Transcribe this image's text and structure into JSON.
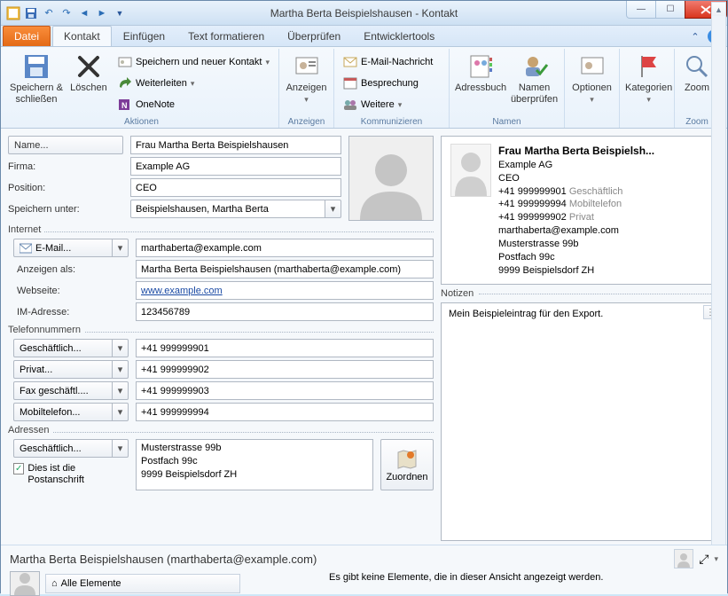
{
  "window": {
    "title": "Martha Berta Beispielshausen  -  Kontakt"
  },
  "tabs": {
    "file": "Datei",
    "items": [
      "Kontakt",
      "Einfügen",
      "Text formatieren",
      "Überprüfen",
      "Entwicklertools"
    ],
    "active_index": 0
  },
  "ribbon": {
    "save_close": "Speichern & schließen",
    "delete": "Löschen",
    "save_new": "Speichern und neuer Kontakt",
    "forward": "Weiterleiten",
    "onenote": "OneNote",
    "group_actions": "Aktionen",
    "show": "Anzeigen",
    "group_show": "Anzeigen",
    "email": "E-Mail-Nachricht",
    "meeting": "Besprechung",
    "more": "Weitere",
    "group_comm": "Kommunizieren",
    "addressbook": "Adressbuch",
    "checknames": "Namen überprüfen",
    "group_names": "Namen",
    "options": "Optionen",
    "categories": "Kategorien",
    "zoom": "Zoom",
    "group_zoom": "Zoom"
  },
  "form": {
    "name_btn": "Name...",
    "name_val": "Frau Martha Berta Beispielshausen",
    "firma_lbl": "Firma:",
    "firma_val": "Example AG",
    "position_lbl": "Position:",
    "position_val": "CEO",
    "fileas_lbl": "Speichern unter:",
    "fileas_val": "Beispielshausen, Martha Berta",
    "internet_hdr": "Internet",
    "email_btn": "E-Mail...",
    "email_val": "marthaberta@example.com",
    "displayas_lbl": "Anzeigen als:",
    "displayas_val": "Martha Berta Beispielshausen (marthaberta@example.com)",
    "web_lbl": "Webseite:",
    "web_val": "www.example.com",
    "im_lbl": "IM-Adresse:",
    "im_val": "123456789",
    "phone_hdr": "Telefonnummern",
    "phone1_btn": "Geschäftlich...",
    "phone1_val": "+41 999999901",
    "phone2_btn": "Privat...",
    "phone2_val": "+41 999999902",
    "phone3_btn": "Fax geschäftl....",
    "phone3_val": "+41 999999903",
    "phone4_btn": "Mobiltelefon...",
    "phone4_val": "+41 999999994",
    "addr_hdr": "Adressen",
    "addr_btn": "Geschäftlich...",
    "addr_line1": "Musterstrasse 99b",
    "addr_line2": "Postfach 99c",
    "addr_line3": "9999  Beispielsdorf  ZH",
    "mailing_chk": "Dies ist die Postanschrift",
    "map_btn": "Zuordnen"
  },
  "card": {
    "name": "Frau Martha Berta Beispielsh...",
    "firma": "Example AG",
    "title": "CEO",
    "p1": "+41 999999901",
    "p1t": "Geschäftlich",
    "p2": "+41 999999994",
    "p2t": "Mobiltelefon",
    "p3": "+41 999999902",
    "p3t": "Privat",
    "email": "marthaberta@example.com",
    "a1": "Musterstrasse 99b",
    "a2": "Postfach 99c",
    "a3": "9999  Beispielsdorf  ZH"
  },
  "notes": {
    "label": "Notizen",
    "text": "Mein Beispieleintrag für den Export."
  },
  "bottom": {
    "name": "Martha Berta Beispielshausen (marthaberta@example.com)",
    "all": "Alle Elemente",
    "empty": "Es gibt keine Elemente, die in dieser Ansicht angezeigt werden."
  }
}
